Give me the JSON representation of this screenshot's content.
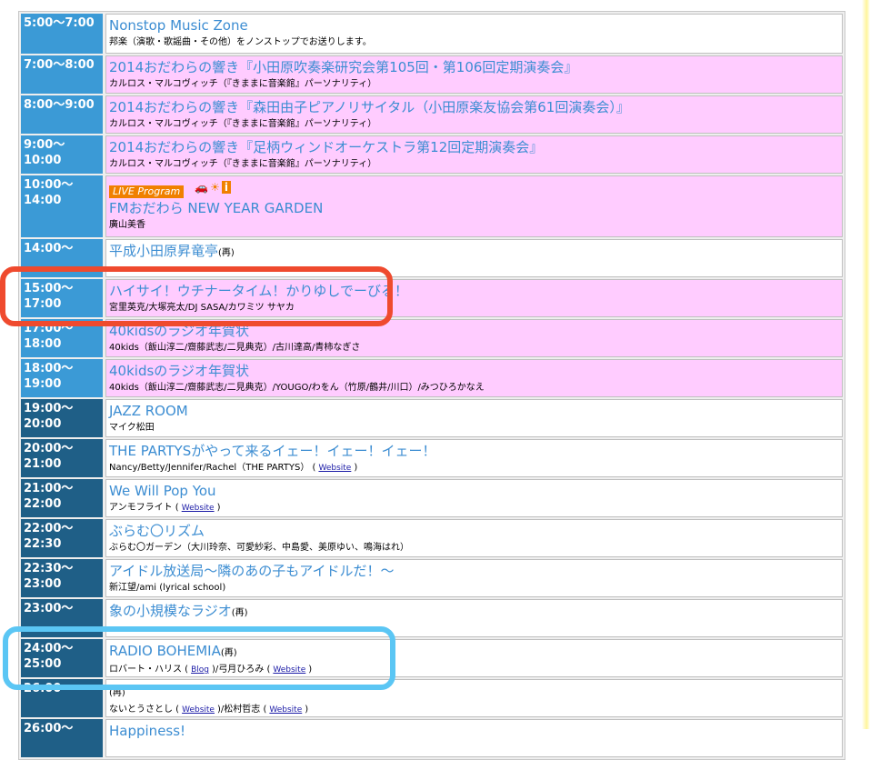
{
  "schedule": [
    {
      "time": "5:00〜7:00",
      "title": "Nonstop Music Zone",
      "rerun": false,
      "sub": "邦楽（演歌・歌謡曲・その他）をノンストップでお送りします。",
      "links": [],
      "pink": false,
      "night": false,
      "h": 44
    },
    {
      "time": "7:00〜8:00",
      "title": "2014おだわらの響き『小田原吹奏楽研究会第105回・第106回定期演奏会』",
      "rerun": false,
      "sub": "カルロス・マルコヴィッチ（『きままに音楽館』パーソナリティ）",
      "links": [],
      "pink": true,
      "night": false,
      "h": 42
    },
    {
      "time": "8:00〜9:00",
      "title": "2014おだわらの響き『森田由子ピアノリサイタル（小田原楽友協会第61回演奏会）』",
      "rerun": false,
      "sub": "カルロス・マルコヴィッチ（『きままに音楽館』パーソナリティ）",
      "links": [],
      "pink": true,
      "night": false,
      "h": 42
    },
    {
      "time": "9:00〜10:00",
      "title": "2014おだわらの響き『足柄ウィンドオーケストラ第12回定期演奏会』",
      "rerun": false,
      "sub": "カルロス・マルコヴィッチ（『きままに音楽館』パーソナリティ）",
      "links": [],
      "pink": true,
      "night": false,
      "h": 42
    },
    {
      "time": "10:00〜 14:00",
      "title": "FMおだわら NEW YEAR GARDEN",
      "rerun": false,
      "sub": "廣山美香",
      "links": [],
      "pink": true,
      "night": false,
      "h": 68,
      "live": "LIVE Program"
    },
    {
      "time": "14:00〜",
      "title": "平成小田原昇竜亭",
      "rerun": true,
      "sub": "",
      "links": [],
      "pink": false,
      "night": false,
      "h": 42
    },
    {
      "time": "15:00〜 17:00",
      "title": "ハイサイ！ウチナータイム！かりゆしでーびる！",
      "rerun": false,
      "sub": "宮里英克/大塚亮太/DJ SASA/カワミツ サヤカ",
      "links": [],
      "pink": true,
      "night": false,
      "h": 42
    },
    {
      "time": "17:00〜 18:00",
      "title": "40kidsのラジオ年賀状",
      "rerun": false,
      "sub": "40kids（飯山淳二/齋藤武志/二見典克）/古川達高/青柿なぎさ",
      "links": [],
      "pink": true,
      "night": false,
      "h": 42
    },
    {
      "time": "18:00〜 19:00",
      "title": "40kidsのラジオ年賀状",
      "rerun": false,
      "sub": "40kids（飯山淳二/齋藤武志/二見典克）/YOUGO/わをん（竹原/鶴井/川口）/みつひろかなえ",
      "links": [],
      "pink": true,
      "night": false,
      "h": 42
    },
    {
      "time": "19:00〜 20:00",
      "title": "JAZZ ROOM",
      "rerun": false,
      "sub": "マイク松田",
      "links": [],
      "pink": false,
      "night": true,
      "h": 42
    },
    {
      "time": "20:00〜 21:00",
      "title": "THE PARTYSがやって来るイェー！イェー！イェー！",
      "rerun": false,
      "sub": "Nancy/Betty/Jennifer/Rachel（THE PARTYS）",
      "links": [
        "Website"
      ],
      "pink": false,
      "night": true,
      "h": 42
    },
    {
      "time": "21:00〜 22:00",
      "title": "We Will Pop You",
      "rerun": false,
      "sub": "アンモフライト",
      "links": [
        "Website"
      ],
      "pink": false,
      "night": true,
      "h": 42
    },
    {
      "time": "22:00〜 22:30",
      "title": "ぶらむ〇リズム",
      "rerun": false,
      "sub": "ぶらむ〇ガーデン（大川玲奈、可愛紗彩、中島愛、美原ゆい、鳴海はれ）",
      "links": [],
      "pink": false,
      "night": true,
      "h": 42
    },
    {
      "time": "22:30〜 23:00",
      "title": "アイドル放送局〜隣のあの子もアイドルだ！〜",
      "rerun": false,
      "sub": "新江望/ami (lyrical school)",
      "links": [],
      "pink": false,
      "night": true,
      "h": 42
    },
    {
      "time": "23:00〜",
      "title": "象の小規模なラジオ",
      "rerun": true,
      "sub": "",
      "links": [],
      "pink": false,
      "night": true,
      "h": 42
    },
    {
      "time": "24:00〜 25:00",
      "title": "RADIO BOHEMIA",
      "rerun": true,
      "sub": "ロバート・ハリス",
      "links": [
        "Blog"
      ],
      "sub2": "/弓月ひろみ",
      "links2": [
        "Website"
      ],
      "pink": false,
      "night": true,
      "h": 42
    },
    {
      "time": "26:00",
      "title": "",
      "rerun": true,
      "sub": "ないとうさとし",
      "links": [
        "Website"
      ],
      "sub2": "/松村哲志",
      "links2": [
        "Website"
      ],
      "pink": false,
      "night": true,
      "h": 42
    },
    {
      "time": "26:00〜",
      "title": "Happiness!",
      "rerun": false,
      "sub": "",
      "links": [],
      "pink": false,
      "night": true,
      "h": 42
    }
  ],
  "rerun_mark": "(再)",
  "colors": {
    "highlight_red": "#ef4a2e",
    "highlight_blue": "#5bc6f4",
    "time_day": "#3b9ad6",
    "time_night": "#1f5f87",
    "pink": "#ffccff"
  }
}
